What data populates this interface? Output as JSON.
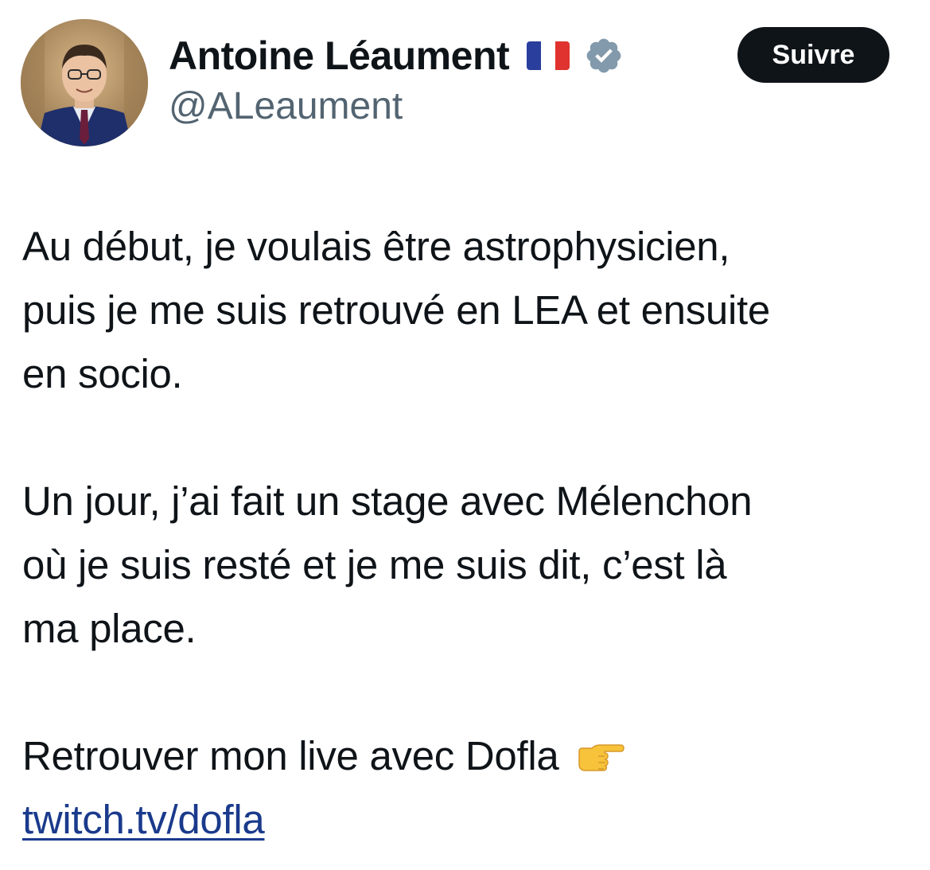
{
  "author": {
    "display_name": "Antoine Léaument",
    "handle": "@ALeaument",
    "flag_icon": "france-flag-icon",
    "verified_icon": "verified-badge-icon",
    "verified_color": "#829aab"
  },
  "follow_button": {
    "label": "Suivre"
  },
  "tweet": {
    "lines_para1": [
      "Au début, je voulais être astrophysicien,",
      "puis je me suis retrouvé en LEA et ensuite",
      "en socio."
    ],
    "lines_para2": [
      "Un jour, j’ai fait un stage avec Mélenchon",
      "où je suis resté et je me suis dit, c’est là",
      "ma place."
    ],
    "line_para3": "Retrouver mon live avec Dofla",
    "emoji_icon": "pointing-right-hand-icon",
    "link_text": "twitch.tv/dofla"
  },
  "colors": {
    "text": "#0f1419",
    "secondary_text": "#536471",
    "link": "#1a3a8c",
    "button_bg": "#0f1419",
    "button_text": "#ffffff"
  }
}
